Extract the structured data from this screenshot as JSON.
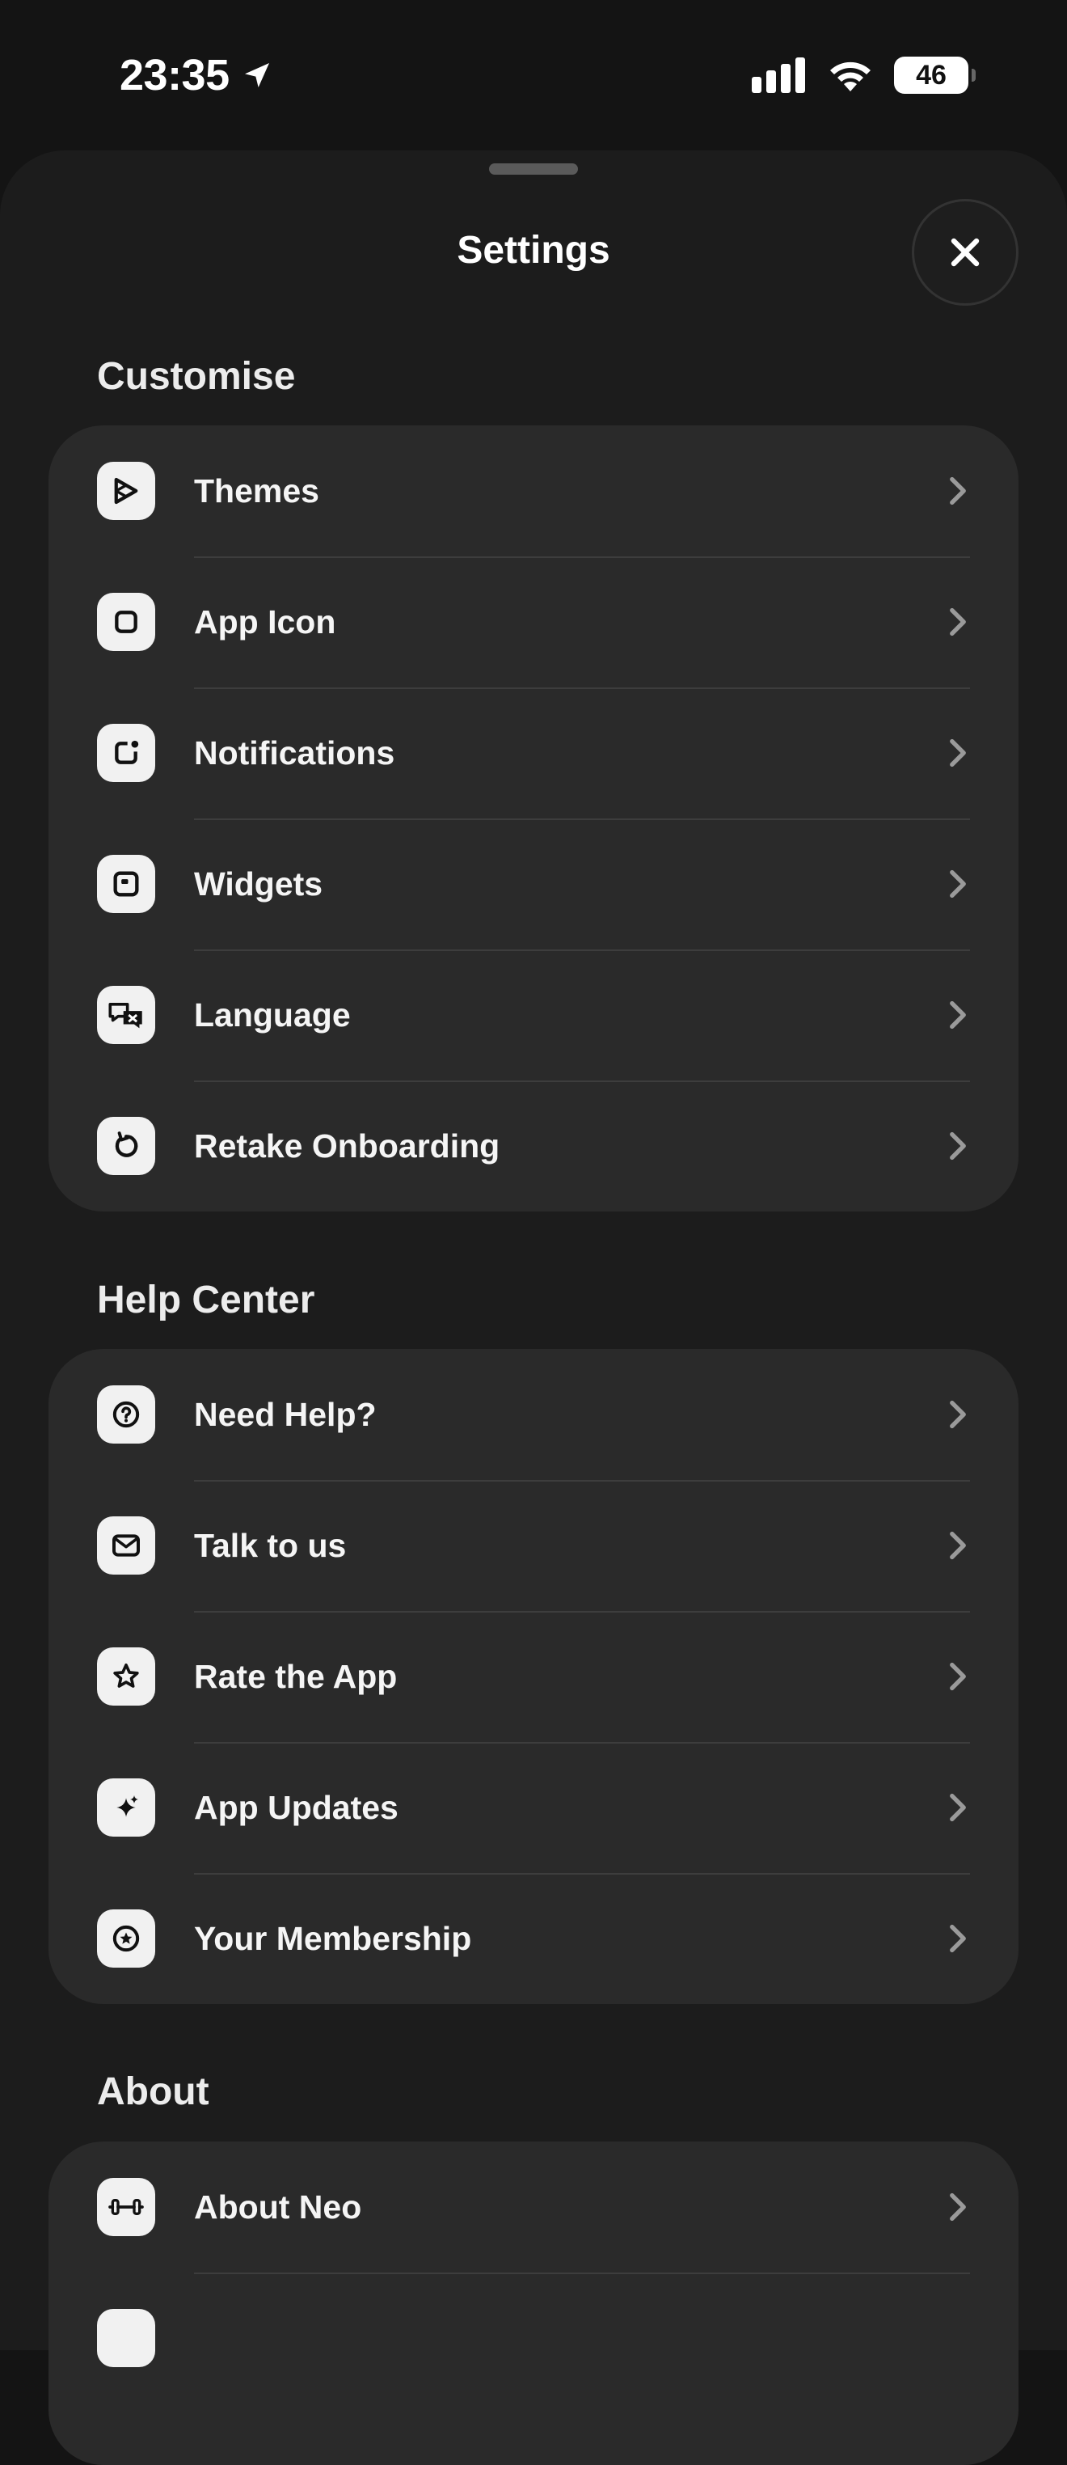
{
  "status": {
    "time": "23:35",
    "battery": "46",
    "icons": [
      "location-arrow-icon",
      "cellular-signal-icon",
      "wifi-icon",
      "battery-icon"
    ]
  },
  "header": {
    "title": "Settings",
    "close_icon": "close-icon"
  },
  "sections": [
    {
      "title": "Customise",
      "items": [
        {
          "label": "Themes",
          "icon": "palette-icon"
        },
        {
          "label": "App Icon",
          "icon": "app-icon-square-icon"
        },
        {
          "label": "Notifications",
          "icon": "notification-badge-icon"
        },
        {
          "label": "Widgets",
          "icon": "widget-icon"
        },
        {
          "label": "Language",
          "icon": "translate-icon"
        },
        {
          "label": "Retake Onboarding",
          "icon": "restart-icon"
        }
      ]
    },
    {
      "title": "Help Center",
      "items": [
        {
          "label": "Need Help?",
          "icon": "question-icon"
        },
        {
          "label": "Talk to us",
          "icon": "envelope-icon"
        },
        {
          "label": "Rate the App",
          "icon": "star-icon"
        },
        {
          "label": "App Updates",
          "icon": "sparkle-icon"
        },
        {
          "label": "Your Membership",
          "icon": "membership-badge-icon"
        }
      ]
    },
    {
      "title": "About",
      "items": [
        {
          "label": "About Neo",
          "icon": "dumbbell-icon"
        }
      ]
    }
  ],
  "colors": {
    "background": "#141414",
    "sheet": "#1c1c1c",
    "group": "#2a2a2a",
    "icon_tile": "#f1f1f1",
    "text": "#ffffff"
  }
}
